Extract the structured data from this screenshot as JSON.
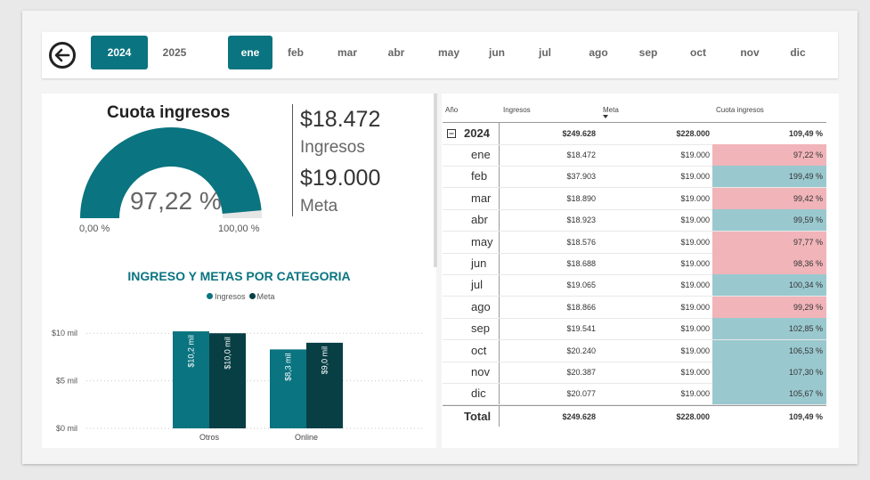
{
  "filters": {
    "years": [
      {
        "label": "2024",
        "selected": true
      },
      {
        "label": "2025",
        "selected": false
      }
    ],
    "months": [
      {
        "label": "ene",
        "selected": true
      },
      {
        "label": "feb",
        "selected": false
      },
      {
        "label": "mar",
        "selected": false
      },
      {
        "label": "abr",
        "selected": false
      },
      {
        "label": "may",
        "selected": false
      },
      {
        "label": "jun",
        "selected": false
      },
      {
        "label": "jul",
        "selected": false
      },
      {
        "label": "ago",
        "selected": false
      },
      {
        "label": "sep",
        "selected": false
      },
      {
        "label": "oct",
        "selected": false
      },
      {
        "label": "nov",
        "selected": false
      },
      {
        "label": "dic",
        "selected": false
      }
    ]
  },
  "gauge": {
    "title": "Cuota ingresos",
    "value_label": "97,22 %",
    "value": 0.9722,
    "min_label": "0,00 %",
    "max_label": "100,00 %",
    "fill_color": "#0a7480",
    "track_color": "#e6e6e6"
  },
  "kpis": {
    "ingresos_value": "$18.472",
    "ingresos_label": "Ingresos",
    "meta_value": "$19.000",
    "meta_label": "Meta"
  },
  "chart_data": {
    "type": "bar",
    "title": "INGRESO Y METAS POR CATEGORIA",
    "categories": [
      "Otros",
      "Online"
    ],
    "series": [
      {
        "name": "Ingresos",
        "values": [
          10.2,
          8.3
        ],
        "labels": [
          "$10,2 mil",
          "$8,3 mil"
        ],
        "color": "#0a7480"
      },
      {
        "name": "Meta",
        "values": [
          10.0,
          9.0
        ],
        "labels": [
          "$10,0 mil",
          "$9,0 mil"
        ],
        "color": "#073f45"
      }
    ],
    "yticks": [
      {
        "v": 0,
        "label": "$0 mil"
      },
      {
        "v": 5,
        "label": "$5 mil"
      },
      {
        "v": 10,
        "label": "$10 mil"
      }
    ],
    "ylim": [
      0,
      10.3
    ],
    "legend": "top-center",
    "grid": true
  },
  "table": {
    "headers": {
      "year": "Año",
      "ingresos": "Ingresos",
      "meta": "Meta",
      "cuota": "Cuota ingresos"
    },
    "year_row": {
      "year": "2024",
      "ingresos": "$249.628",
      "meta": "$228.000",
      "cuota": "109,49 %"
    },
    "rows": [
      {
        "month": "ene",
        "ingresos": "$18.472",
        "meta": "$19.000",
        "cuota": "97,22 %",
        "below": true
      },
      {
        "month": "feb",
        "ingresos": "$37.903",
        "meta": "$19.000",
        "cuota": "199,49 %",
        "below": false
      },
      {
        "month": "mar",
        "ingresos": "$18.890",
        "meta": "$19.000",
        "cuota": "99,42 %",
        "below": true
      },
      {
        "month": "abr",
        "ingresos": "$18.923",
        "meta": "$19.000",
        "cuota": "99,59 %",
        "below": false
      },
      {
        "month": "may",
        "ingresos": "$18.576",
        "meta": "$19.000",
        "cuota": "97,77 %",
        "below": true
      },
      {
        "month": "jun",
        "ingresos": "$18.688",
        "meta": "$19.000",
        "cuota": "98,36 %",
        "below": true
      },
      {
        "month": "jul",
        "ingresos": "$19.065",
        "meta": "$19.000",
        "cuota": "100,34 %",
        "below": false
      },
      {
        "month": "ago",
        "ingresos": "$18.866",
        "meta": "$19.000",
        "cuota": "99,29 %",
        "below": true
      },
      {
        "month": "sep",
        "ingresos": "$19.541",
        "meta": "$19.000",
        "cuota": "102,85 %",
        "below": false
      },
      {
        "month": "oct",
        "ingresos": "$20.240",
        "meta": "$19.000",
        "cuota": "106,53 %",
        "below": false
      },
      {
        "month": "nov",
        "ingresos": "$20.387",
        "meta": "$19.000",
        "cuota": "107,30 %",
        "below": false
      },
      {
        "month": "dic",
        "ingresos": "$20.077",
        "meta": "$19.000",
        "cuota": "105,67 %",
        "below": false
      }
    ],
    "total_row": {
      "label": "Total",
      "ingresos": "$249.628",
      "meta": "$228.000",
      "cuota": "109,49 %"
    },
    "colors": {
      "below": "#f0b4b9",
      "above": "#9ac8cf"
    }
  }
}
